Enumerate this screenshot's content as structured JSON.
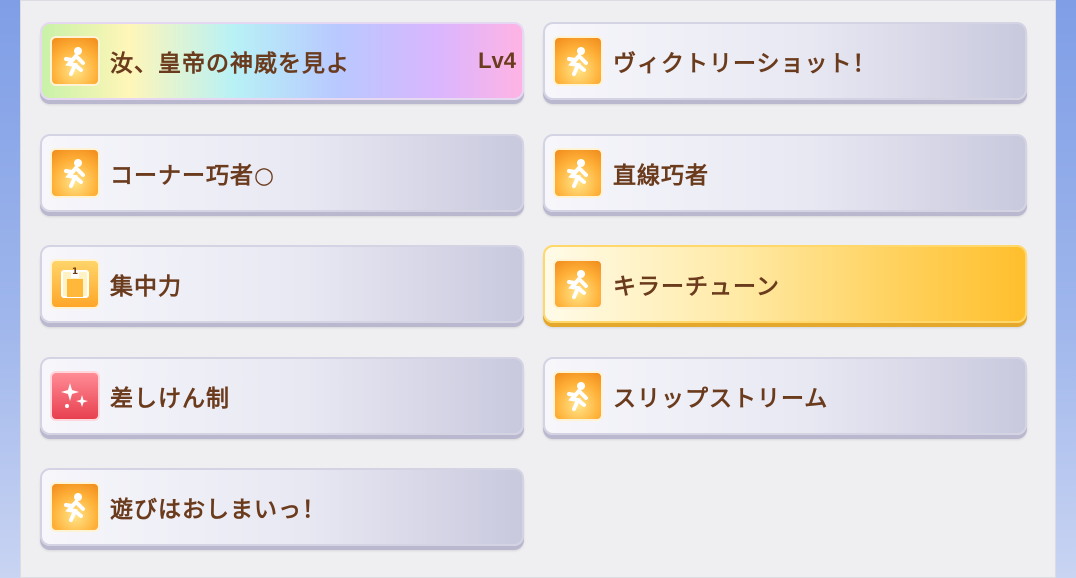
{
  "skills": [
    {
      "name": "汝、皇帝の神威を見よ",
      "level": "Lv4",
      "icon": "running-speed-icon",
      "style": "rainbow"
    },
    {
      "name": "ヴィクトリーショット！",
      "icon": "running-speed-icon",
      "style": "normal"
    },
    {
      "name": "コーナー巧者○",
      "icon": "running-speed-icon",
      "style": "normal"
    },
    {
      "name": "直線巧者",
      "icon": "running-speed-icon",
      "style": "normal"
    },
    {
      "name": "集中力",
      "icon": "gate-focus-icon",
      "style": "normal"
    },
    {
      "name": "キラーチューン",
      "icon": "running-speed-icon",
      "style": "gold"
    },
    {
      "name": "差しけん制",
      "icon": "sparkle-debuff-icon",
      "style": "normal"
    },
    {
      "name": "スリップストリーム",
      "icon": "running-speed-icon",
      "style": "normal"
    },
    {
      "name": "遊びはおしまいっ！",
      "icon": "running-speed-icon",
      "style": "normal"
    }
  ],
  "gate_number": "1",
  "colors": {
    "label": "#6b3b1d",
    "gold_accent": "#ffbf2d",
    "panel": "#efeff2"
  }
}
